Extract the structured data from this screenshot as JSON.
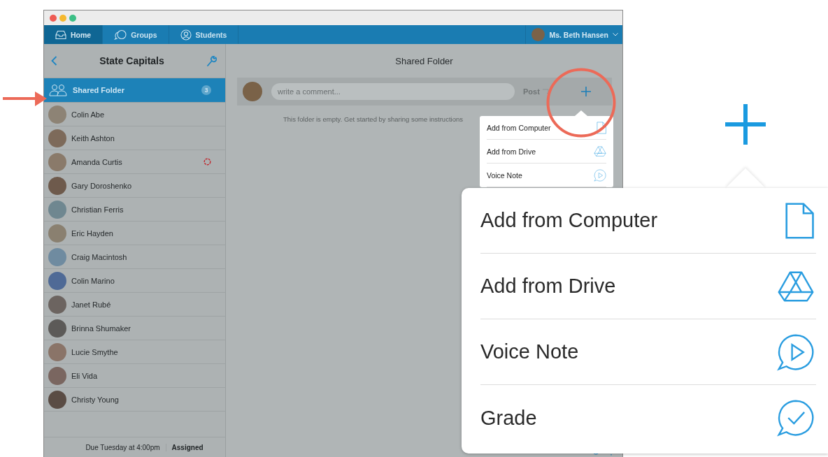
{
  "nav": {
    "tabs": [
      {
        "label": "Home",
        "selected": true
      },
      {
        "label": "Groups",
        "selected": false
      },
      {
        "label": "Students",
        "selected": false
      }
    ],
    "user": "Ms. Beth Hansen"
  },
  "sidebar": {
    "title": "State Capitals",
    "items": [
      {
        "kind": "folder",
        "label": "Shared Folder",
        "count": "3",
        "selected": true,
        "status_ring": false
      },
      {
        "kind": "student",
        "label": "Colin Abe",
        "selected": false,
        "status_ring": false
      },
      {
        "kind": "student",
        "label": "Keith Ashton",
        "selected": false,
        "status_ring": false
      },
      {
        "kind": "student",
        "label": "Amanda Curtis",
        "selected": false,
        "status_ring": true
      },
      {
        "kind": "student",
        "label": "Gary Doroshenko",
        "selected": false,
        "status_ring": false
      },
      {
        "kind": "student",
        "label": "Christian Ferris",
        "selected": false,
        "status_ring": false
      },
      {
        "kind": "student",
        "label": "Eric Hayden",
        "selected": false,
        "status_ring": false
      },
      {
        "kind": "student",
        "label": "Craig Macintosh",
        "selected": false,
        "status_ring": false
      },
      {
        "kind": "student",
        "label": "Colin Marino",
        "selected": false,
        "status_ring": false
      },
      {
        "kind": "student",
        "label": "Janet Rubé",
        "selected": false,
        "status_ring": false
      },
      {
        "kind": "student",
        "label": "Brinna Shumaker",
        "selected": false,
        "status_ring": false
      },
      {
        "kind": "student",
        "label": "Lucie Smythe",
        "selected": false,
        "status_ring": false
      },
      {
        "kind": "student",
        "label": "Eli Vida",
        "selected": false,
        "status_ring": false
      },
      {
        "kind": "student",
        "label": "Christy Young",
        "selected": false,
        "status_ring": false
      }
    ],
    "footer": {
      "due": "Due Tuesday at 4:00pm",
      "status": "Assigned"
    }
  },
  "main": {
    "title": "Shared Folder",
    "comment": {
      "placeholder": "write a comment...",
      "post": "Post"
    },
    "empty_message": "This folder is empty. Get started by sharing some instructions"
  },
  "add_menu": {
    "items": [
      {
        "label": "Add from Computer",
        "kind": "file"
      },
      {
        "label": "Add from Drive",
        "kind": "drive"
      },
      {
        "label": "Voice Note",
        "kind": "voice"
      }
    ]
  },
  "callout_menu": {
    "items": [
      {
        "label": "Add from Computer",
        "kind": "file"
      },
      {
        "label": "Add from Drive",
        "kind": "drive"
      },
      {
        "label": "Voice Note",
        "kind": "voice"
      },
      {
        "label": "Grade",
        "kind": "grade"
      }
    ]
  }
}
